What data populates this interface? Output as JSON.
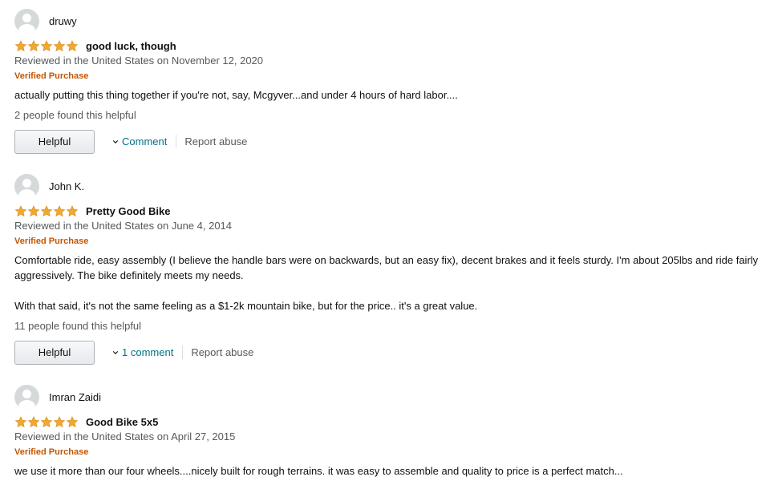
{
  "reviews": [
    {
      "profile_name": "druwy",
      "rating": 5,
      "title": "good luck, though",
      "date": "Reviewed in the United States on November 12, 2020",
      "verified": "Verified Purchase",
      "body": [
        "actually putting this thing together if you're not, say, Mcgyver...and under 4 hours of hard labor...."
      ],
      "helpful_count": "2 people found this helpful",
      "helpful_label": "Helpful",
      "comment_label": "Comment",
      "report_label": "Report abuse"
    },
    {
      "profile_name": "John K.",
      "rating": 5,
      "title": "Pretty Good Bike",
      "date": "Reviewed in the United States on June 4, 2014",
      "verified": "Verified Purchase",
      "body": [
        "Comfortable ride, easy assembly (I believe the handle bars were on backwards, but an easy fix), decent brakes and it feels sturdy. I'm about 205lbs and ride fairly",
        "aggressively. The bike definitely meets my needs.",
        "With that said, it's not the same feeling as a $1-2k mountain bike, but for the price.. it's a great value."
      ],
      "helpful_count": "11 people found this helpful",
      "helpful_label": "Helpful",
      "comment_label": "1 comment",
      "report_label": "Report abuse"
    },
    {
      "profile_name": "Imran Zaidi",
      "rating": 5,
      "title": "Good Bike 5x5",
      "date": "Reviewed in the United States on April 27, 2015",
      "verified": "Verified Purchase",
      "body": [
        "we use it more than our four wheels....nicely built for rough terrains. it was easy to assemble and quality to price is a perfect match..."
      ]
    }
  ],
  "colors": {
    "star": "#f0a830",
    "verified": "#c45500",
    "link": "#007185",
    "muted": "#565959"
  },
  "icons": {
    "avatar": "default-avatar-icon",
    "star": "star-icon",
    "chevron": "chevron-down-icon"
  }
}
